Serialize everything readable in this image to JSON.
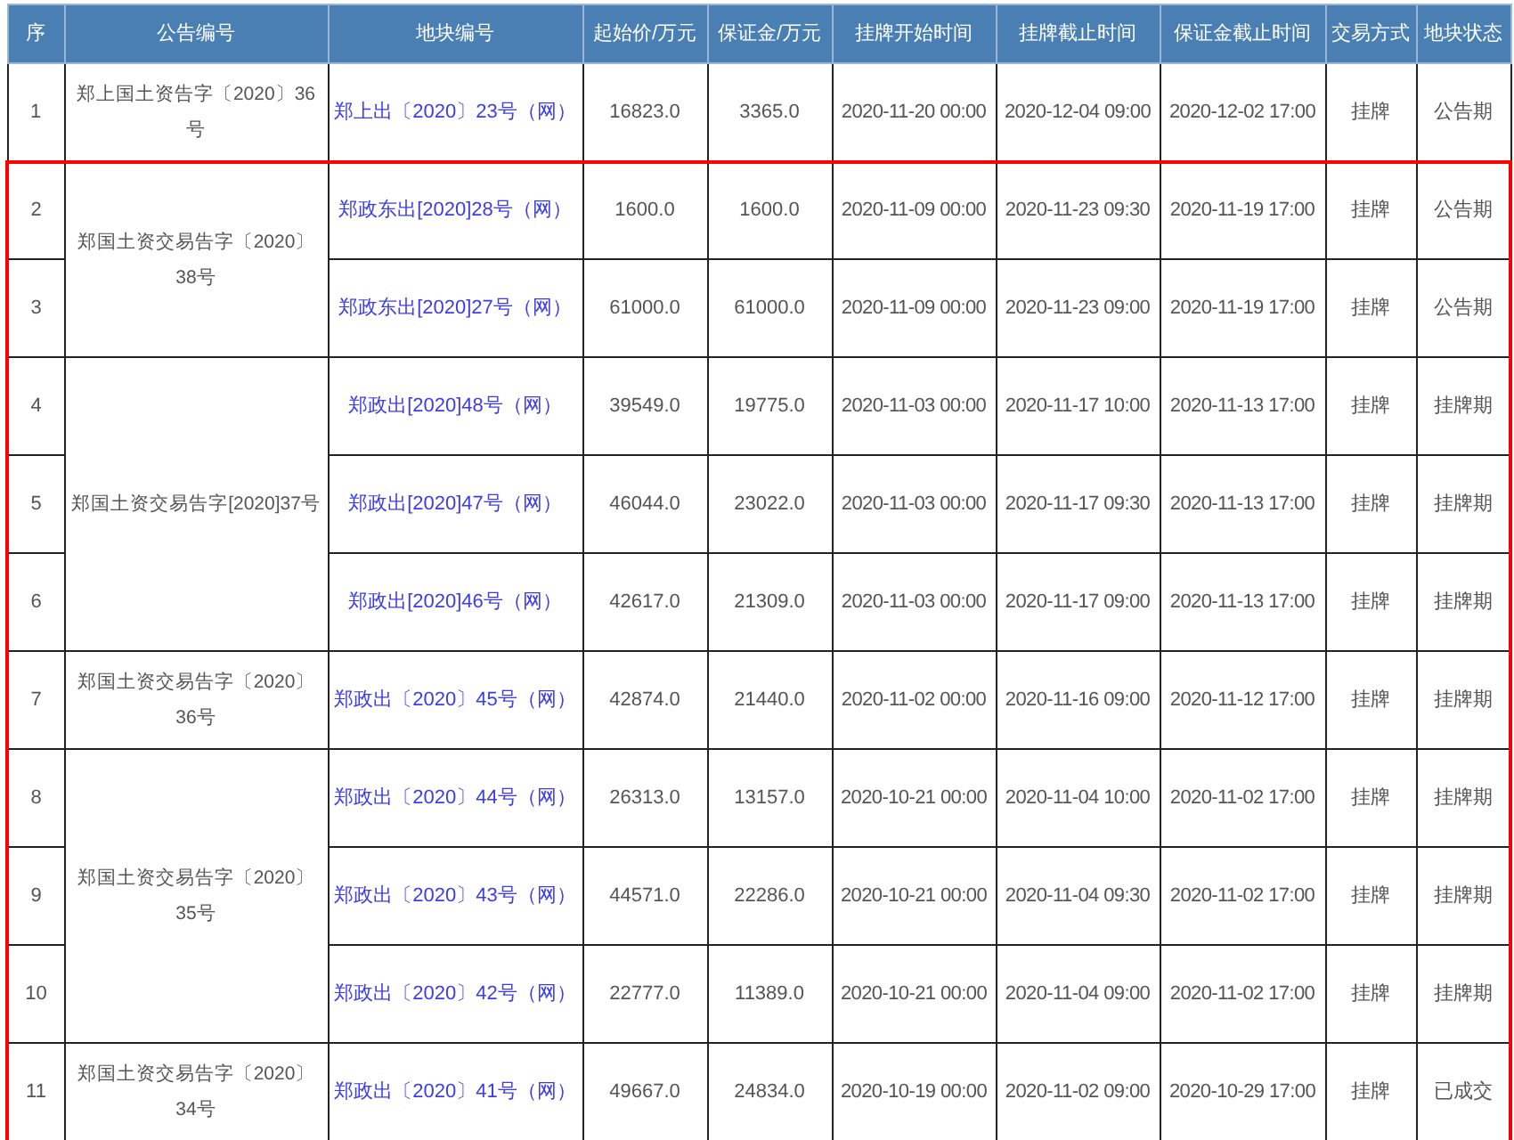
{
  "columns": [
    "序",
    "公告编号",
    "地块编号",
    "起始价/万元",
    "保证金/万元",
    "挂牌开始时间",
    "挂牌截止时间",
    "保证金截止时间",
    "交易方式",
    "地块状态"
  ],
  "groups": [
    {
      "notice": "郑上国土资告字〔2020〕36号",
      "highlighted": false,
      "rows": [
        {
          "no": "1",
          "parcel": "郑上出〔2020〕23号（网）",
          "start_price": "16823.0",
          "deposit": "3365.0",
          "listing_start": "2020-11-20 00:00",
          "listing_end": "2020-12-04 09:00",
          "deposit_deadline": "2020-12-02 17:00",
          "method": "挂牌",
          "status": "公告期"
        }
      ]
    },
    {
      "notice": "郑国土资交易告字〔2020〕38号",
      "highlighted": true,
      "rows": [
        {
          "no": "2",
          "parcel": "郑政东出[2020]28号（网）",
          "start_price": "1600.0",
          "deposit": "1600.0",
          "listing_start": "2020-11-09 00:00",
          "listing_end": "2020-11-23 09:30",
          "deposit_deadline": "2020-11-19 17:00",
          "method": "挂牌",
          "status": "公告期"
        },
        {
          "no": "3",
          "parcel": "郑政东出[2020]27号（网）",
          "start_price": "61000.0",
          "deposit": "61000.0",
          "listing_start": "2020-11-09 00:00",
          "listing_end": "2020-11-23 09:00",
          "deposit_deadline": "2020-11-19 17:00",
          "method": "挂牌",
          "status": "公告期"
        }
      ]
    },
    {
      "notice": "郑国土资交易告字[2020]37号",
      "highlighted": true,
      "rows": [
        {
          "no": "4",
          "parcel": "郑政出[2020]48号（网）",
          "start_price": "39549.0",
          "deposit": "19775.0",
          "listing_start": "2020-11-03 00:00",
          "listing_end": "2020-11-17 10:00",
          "deposit_deadline": "2020-11-13 17:00",
          "method": "挂牌",
          "status": "挂牌期"
        },
        {
          "no": "5",
          "parcel": "郑政出[2020]47号（网）",
          "start_price": "46044.0",
          "deposit": "23022.0",
          "listing_start": "2020-11-03 00:00",
          "listing_end": "2020-11-17 09:30",
          "deposit_deadline": "2020-11-13 17:00",
          "method": "挂牌",
          "status": "挂牌期"
        },
        {
          "no": "6",
          "parcel": "郑政出[2020]46号（网）",
          "start_price": "42617.0",
          "deposit": "21309.0",
          "listing_start": "2020-11-03 00:00",
          "listing_end": "2020-11-17 09:00",
          "deposit_deadline": "2020-11-13 17:00",
          "method": "挂牌",
          "status": "挂牌期"
        }
      ]
    },
    {
      "notice": "郑国土资交易告字〔2020〕36号",
      "highlighted": true,
      "rows": [
        {
          "no": "7",
          "parcel": "郑政出〔2020〕45号（网）",
          "start_price": "42874.0",
          "deposit": "21440.0",
          "listing_start": "2020-11-02 00:00",
          "listing_end": "2020-11-16 09:00",
          "deposit_deadline": "2020-11-12 17:00",
          "method": "挂牌",
          "status": "挂牌期"
        }
      ]
    },
    {
      "notice": "郑国土资交易告字〔2020〕35号",
      "highlighted": true,
      "rows": [
        {
          "no": "8",
          "parcel": "郑政出〔2020〕44号（网）",
          "start_price": "26313.0",
          "deposit": "13157.0",
          "listing_start": "2020-10-21 00:00",
          "listing_end": "2020-11-04 10:00",
          "deposit_deadline": "2020-11-02 17:00",
          "method": "挂牌",
          "status": "挂牌期"
        },
        {
          "no": "9",
          "parcel": "郑政出〔2020〕43号（网）",
          "start_price": "44571.0",
          "deposit": "22286.0",
          "listing_start": "2020-10-21 00:00",
          "listing_end": "2020-11-04 09:30",
          "deposit_deadline": "2020-11-02 17:00",
          "method": "挂牌",
          "status": "挂牌期"
        },
        {
          "no": "10",
          "parcel": "郑政出〔2020〕42号（网）",
          "start_price": "22777.0",
          "deposit": "11389.0",
          "listing_start": "2020-10-21 00:00",
          "listing_end": "2020-11-04 09:00",
          "deposit_deadline": "2020-11-02 17:00",
          "method": "挂牌",
          "status": "挂牌期"
        }
      ]
    },
    {
      "notice": "郑国土资交易告字〔2020〕34号",
      "highlighted": true,
      "rows": [
        {
          "no": "11",
          "parcel": "郑政出〔2020〕41号（网）",
          "start_price": "49667.0",
          "deposit": "24834.0",
          "listing_start": "2020-10-19 00:00",
          "listing_end": "2020-11-02 09:00",
          "deposit_deadline": "2020-10-29 17:00",
          "method": "挂牌",
          "status": "已成交"
        }
      ]
    }
  ]
}
